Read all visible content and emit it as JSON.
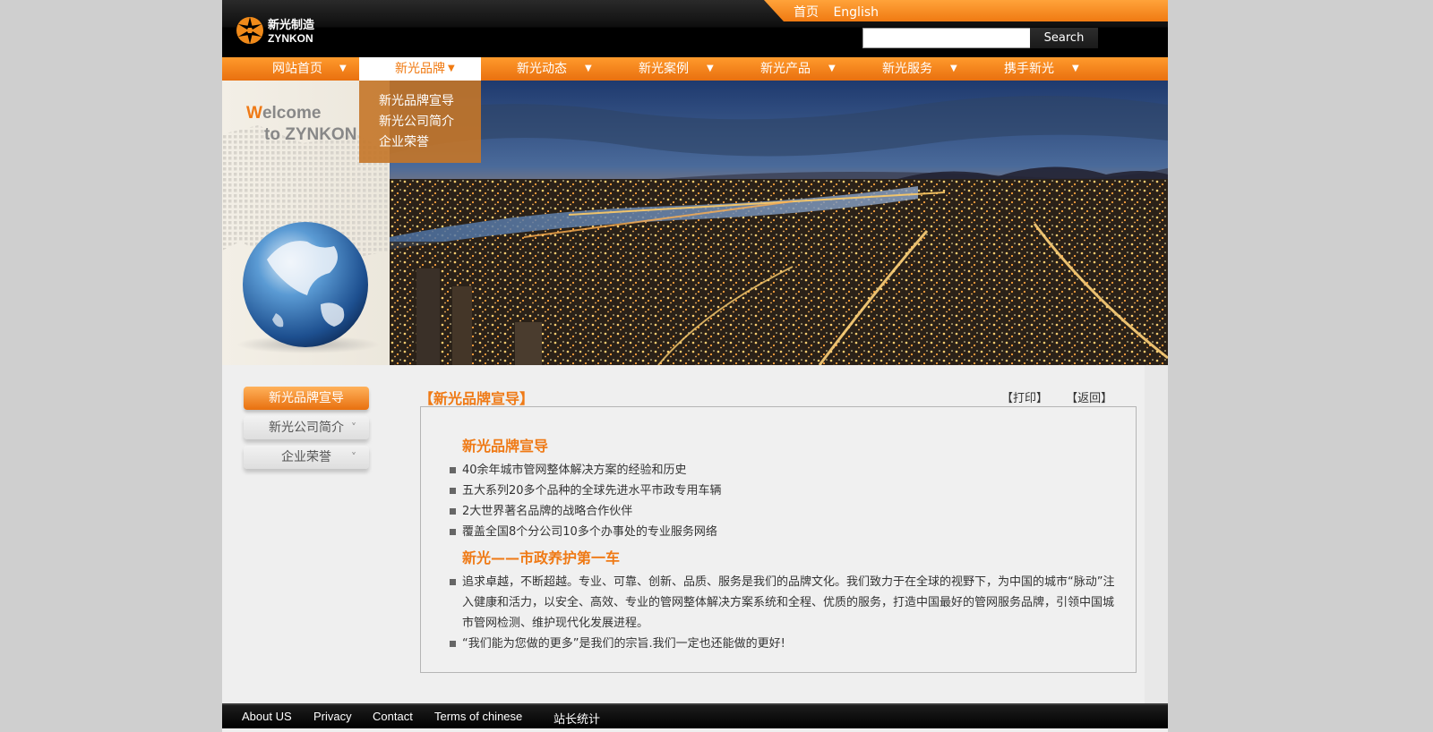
{
  "header": {
    "logo_text_cn": "新光制造",
    "logo_text_en": "ZYNKON",
    "top_links": [
      "首页",
      "English"
    ],
    "search": {
      "placeholder": "",
      "button_label": "Search"
    }
  },
  "nav": {
    "items": [
      {
        "label": "网站首页"
      },
      {
        "label": "新光品牌"
      },
      {
        "label": "新光动态"
      },
      {
        "label": "新光案例"
      },
      {
        "label": "新光产品"
      },
      {
        "label": "新光服务"
      },
      {
        "label": "携手新光"
      }
    ],
    "caret": "▼",
    "dropdown": [
      "新光品牌宣导",
      "新光公司简介",
      "企业荣誉"
    ]
  },
  "banner": {
    "welcome_first": "W",
    "welcome_rest": "elcome",
    "welcome_line2": "to ZYNKON"
  },
  "sidebar": {
    "items": [
      "新光品牌宣导",
      "新光公司简介",
      "企业荣誉"
    ],
    "chevron": "˅"
  },
  "content": {
    "title": "【新光品牌宣导】",
    "print": "【打印】",
    "back": "【返回】",
    "section1_title": "新光品牌宣导",
    "section1_items": [
      "40余年城市管网整体解决方案的经验和历史",
      "五大系列20多个品种的全球先进水平市政专用车辆",
      "2大世界著名品牌的战略合作伙伴",
      "覆盖全国8个分公司10多个办事处的专业服务网络"
    ],
    "section2_title": "新光——市政养护第一车",
    "section2_items": [
      "追求卓越，不断超越。专业、可靠、创新、品质、服务是我们的品牌文化。我们致力于在全球的视野下，为中国的城市“脉动”注入健康和活力，以安全、高效、专业的管网整体解决方案系统和全程、优质的服务，打造中国最好的管网服务品牌，引领中国城市管网检测、维护现代化发展进程。",
      "“我们能为您做的更多”是我们的宗旨.我们一定也还能做的更好!"
    ]
  },
  "footer": {
    "links": [
      "About US",
      "Privacy",
      "Contact",
      "Terms of chinese",
      "站长统计"
    ]
  },
  "colors": {
    "accent": "#ef7a16",
    "header_bg": "#000000",
    "page_bg": "#efefef"
  },
  "icons": [
    "logo-star-icon",
    "caret-down-icon",
    "chevron-down-icon",
    "globe-icon",
    "bullet-square-icon"
  ]
}
